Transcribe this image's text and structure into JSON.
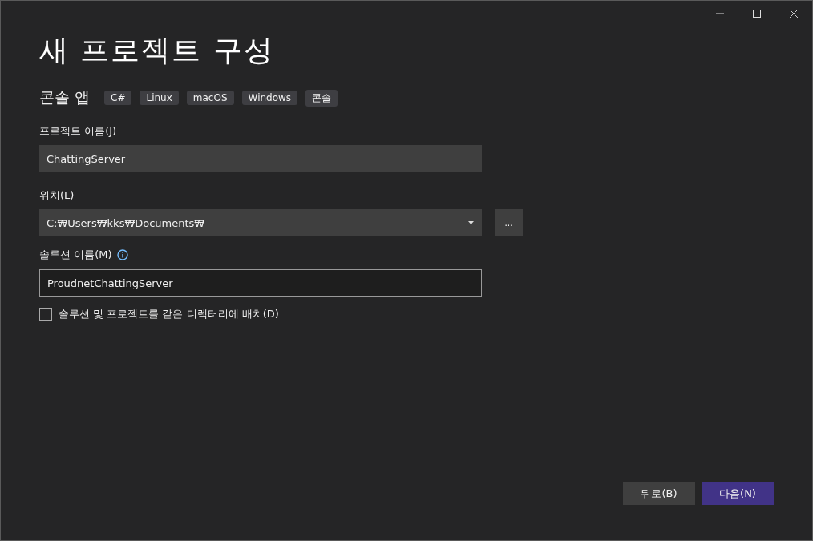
{
  "window": {
    "title": "새 프로젝트 구성"
  },
  "template": {
    "name": "콘솔 앱",
    "tags": [
      "C#",
      "Linux",
      "macOS",
      "Windows",
      "콘솔"
    ]
  },
  "project_name": {
    "label": "프로젝트 이름(J)",
    "value": "ChattingServer"
  },
  "location": {
    "label": "위치(L)",
    "value": "C:₩Users₩kks₩Documents₩",
    "browse": "..."
  },
  "solution_name": {
    "label": "솔루션 이름(M)",
    "value": "ProudnetChattingServer"
  },
  "same_directory": {
    "label": "솔루션 및 프로젝트를 같은 디렉터리에 배치(D)",
    "checked": false
  },
  "buttons": [
    {
      "label": "뒤로(B)",
      "kind": "secondary"
    },
    {
      "label": "다음(N)",
      "kind": "primary"
    }
  ]
}
